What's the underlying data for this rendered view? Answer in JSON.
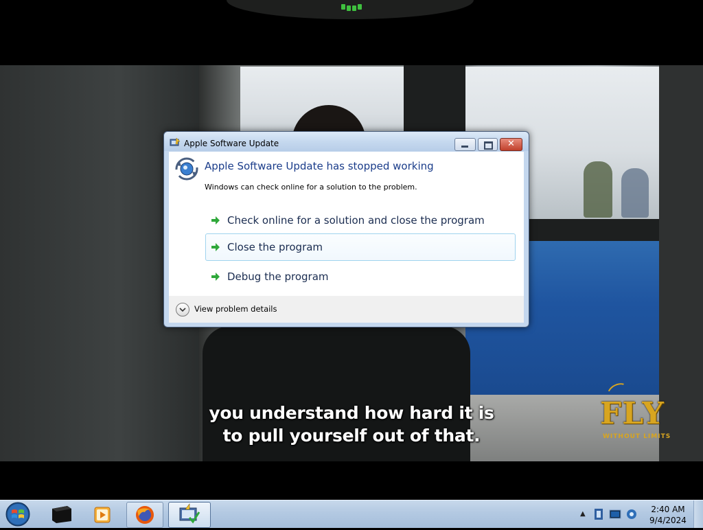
{
  "video": {
    "caption_line1": "you understand how hard it is",
    "caption_line2": "to pull yourself out of that.",
    "logo_text": "FLY",
    "logo_subtext": "WITHOUT LIMITS"
  },
  "dialog": {
    "title": "Apple Software Update",
    "heading": "Apple Software Update has stopped working",
    "subtext": "Windows can check online for a solution to the problem.",
    "options": [
      {
        "label": "Check online for a solution and close the program"
      },
      {
        "label": "Close the program"
      },
      {
        "label": "Debug the program"
      }
    ],
    "details_label": "View problem details",
    "close_glyph": "✕"
  },
  "taskbar": {
    "clock_time": "2:40 AM",
    "clock_date": "9/4/2024",
    "tray_chevron": "▲"
  },
  "colors": {
    "heading": "#1a3c8a",
    "arrow": "#2fa83a",
    "taskbar": "#b3c9e2",
    "logo_gold": "#d8a520"
  }
}
